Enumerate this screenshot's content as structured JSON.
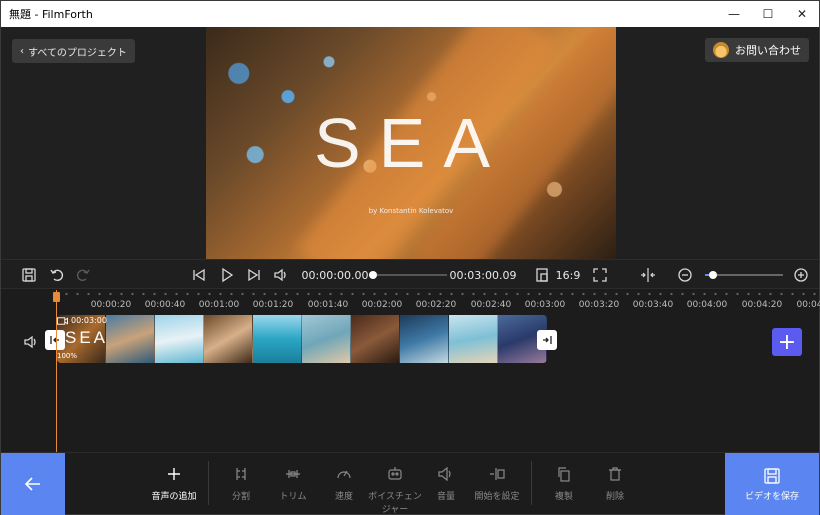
{
  "window": {
    "title": "無題 - FilmForth"
  },
  "header": {
    "back_label": "すべてのプロジェクト",
    "contact_label": "お問い合わせ"
  },
  "preview": {
    "overlay_title": "SEA",
    "overlay_byline": "by Konstantin Kolevatov"
  },
  "controls": {
    "current_time": "00:00:00.00",
    "total_time": "00:03:00.09",
    "aspect_ratio": "16:9",
    "playback_progress": 0,
    "zoom_level": 0.1
  },
  "timeline": {
    "ruler_ticks": [
      "00:00:20",
      "00:00:40",
      "00:01:00",
      "00:01:20",
      "00:01:40",
      "00:02:00",
      "00:02:20",
      "00:02:40",
      "00:03:00",
      "00:03:20",
      "00:03:40",
      "00:04:00",
      "00:04:20",
      "00:04:"
    ],
    "clip": {
      "duration": "00:03:00",
      "volume": "100%",
      "title": "SEA"
    }
  },
  "toolbar": {
    "add_audio": "音声の追加",
    "split": "分割",
    "trim": "トリム",
    "speed": "速度",
    "voice_changer": "ボイスチェンジャー",
    "volume": "音量",
    "set_start": "開始を設定",
    "duplicate": "複製",
    "delete": "削除",
    "save_video": "ビデオを保存"
  },
  "colors": {
    "accent": "#5b86f2",
    "playhead": "#e78a3a",
    "add_button": "#5b5bf0"
  }
}
